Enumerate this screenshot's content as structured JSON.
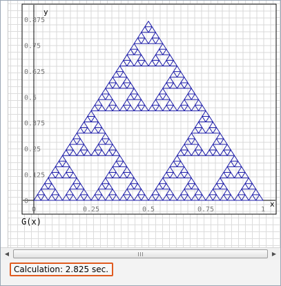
{
  "plot": {
    "y_axis_label": "y",
    "x_axis_label": "x",
    "y_ticks": [
      "0",
      "0.125",
      "0.25",
      "0.375",
      "0.5",
      "0.625",
      "0.75",
      "0.875"
    ],
    "x_ticks": [
      "0",
      "0.25",
      "0.5",
      "0.75",
      "1"
    ],
    "function_label_prefix": "G",
    "function_label_arg": "x",
    "curve_color": "#1a1aa8",
    "fractal": "sierpinski-triangle",
    "recursion_depth": 5
  },
  "chart_data": {
    "type": "line",
    "title": "",
    "xlabel": "x",
    "ylabel": "y",
    "xlim": [
      0,
      1
    ],
    "ylim": [
      0,
      0.875
    ],
    "x_ticks": [
      0,
      0.25,
      0.5,
      0.75,
      1
    ],
    "y_ticks": [
      0,
      0.125,
      0.25,
      0.375,
      0.5,
      0.625,
      0.75,
      0.875
    ],
    "series": [
      {
        "shape": "sierpinski-triangle",
        "vertices": [
          [
            0,
            0
          ],
          [
            1,
            0
          ],
          [
            0.5,
            0.866
          ]
        ],
        "depth": 5
      }
    ],
    "grid": true,
    "legend": "none"
  },
  "scrollbar": {
    "left_arrow": "◀",
    "right_arrow": "▶"
  },
  "status": {
    "calculation_text": "Calculation: 2.825 sec."
  }
}
